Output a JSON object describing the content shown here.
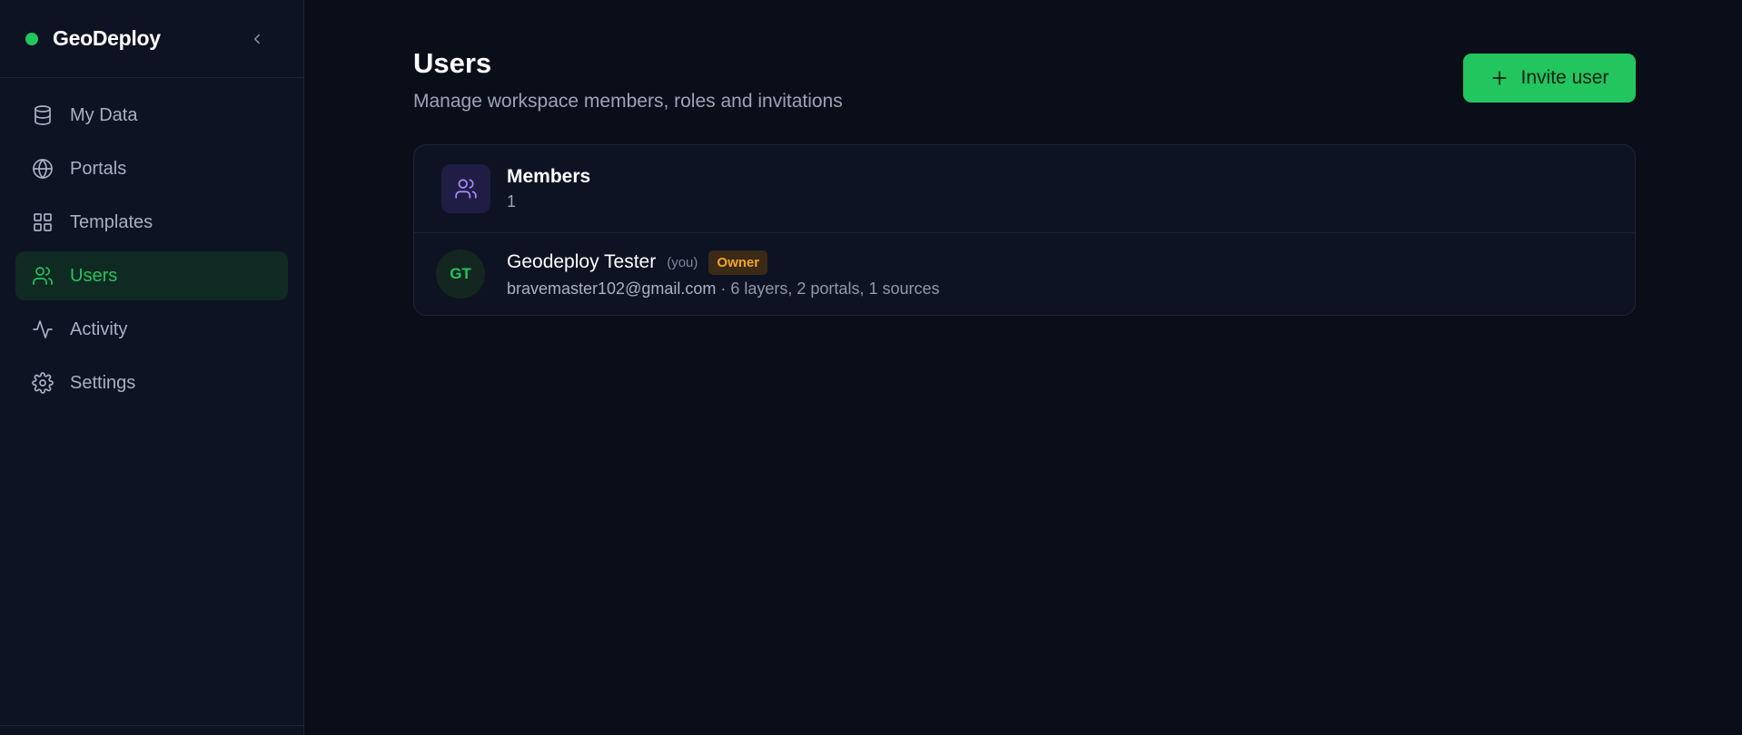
{
  "brand": {
    "name": "GeoDeploy",
    "accent": "#22c55e"
  },
  "sidebar": {
    "items": [
      {
        "label": "My Data",
        "icon": "database-icon",
        "active": false
      },
      {
        "label": "Portals",
        "icon": "globe-icon",
        "active": false
      },
      {
        "label": "Templates",
        "icon": "grid-icon",
        "active": false
      },
      {
        "label": "Users",
        "icon": "users-icon",
        "active": true
      },
      {
        "label": "Activity",
        "icon": "activity-icon",
        "active": false
      },
      {
        "label": "Settings",
        "icon": "gear-icon",
        "active": false
      }
    ]
  },
  "header": {
    "title": "Users",
    "subtitle": "Manage workspace members, roles and invitations",
    "invite_label": "Invite user"
  },
  "members": {
    "title": "Members",
    "count": "1",
    "users": [
      {
        "initials": "GT",
        "name": "Geodeploy Tester",
        "you_tag": "(you)",
        "role": "Owner",
        "email": "bravemaster102@gmail.com",
        "stats": " · 6 layers, 2 portals, 1 sources"
      }
    ]
  }
}
